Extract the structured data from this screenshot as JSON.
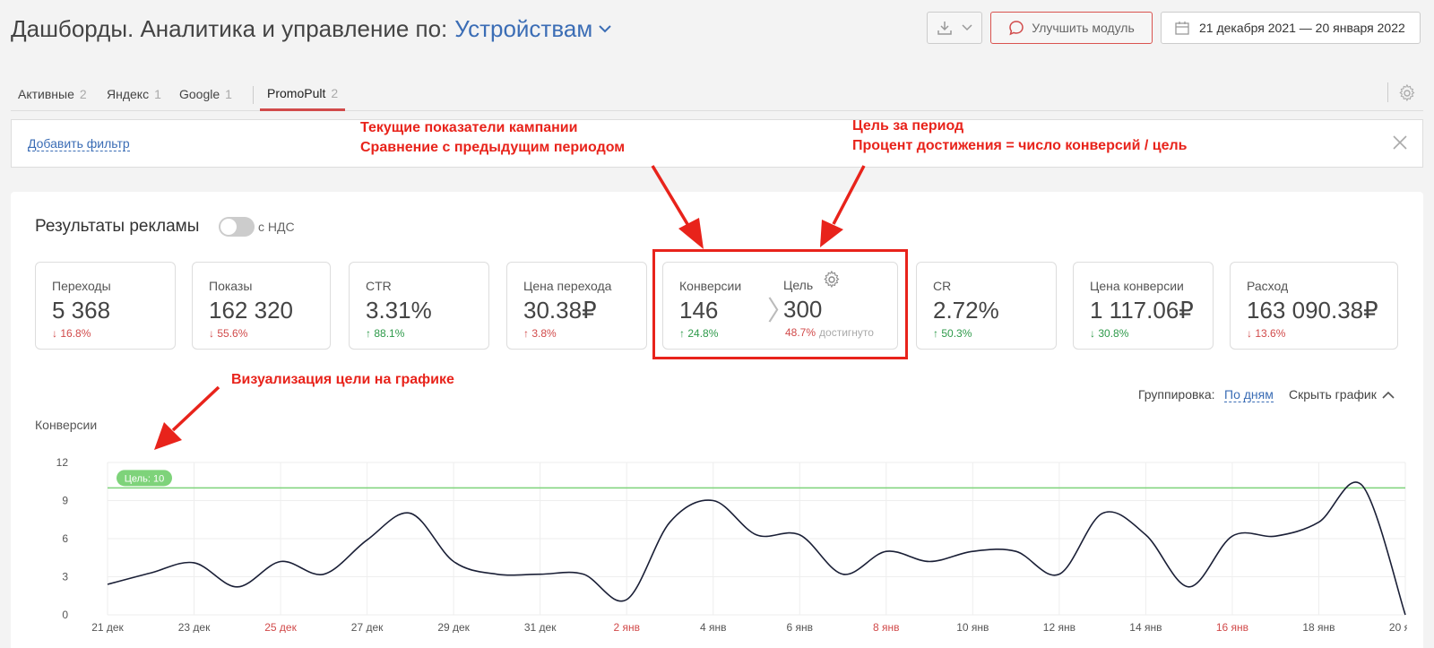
{
  "header": {
    "title": "Дашборды. Аналитика и управление по:",
    "dimension": "Устройствам",
    "improve_label": "Улучшить модуль",
    "date_range": "21 декабря 2021 — 20 января 2022"
  },
  "tabs": [
    {
      "label": "Активные",
      "count": "2"
    },
    {
      "label": "Яндекс",
      "count": "1"
    },
    {
      "label": "Google",
      "count": "1"
    },
    {
      "label": "PromoPult",
      "count": "2"
    }
  ],
  "filter": {
    "add_label": "Добавить фильтр"
  },
  "results": {
    "title": "Результаты рекламы",
    "vat_label": "с НДС",
    "vat_on": false
  },
  "metrics": [
    {
      "label": "Переходы",
      "value": "5 368",
      "delta": "16.8%",
      "direction": "down"
    },
    {
      "label": "Показы",
      "value": "162 320",
      "delta": "55.6%",
      "direction": "down"
    },
    {
      "label": "CTR",
      "value": "3.31%",
      "delta": "88.1%",
      "direction": "up"
    },
    {
      "label": "Цена перехода",
      "value": "30.38₽",
      "delta": "3.8%",
      "direction": "down"
    },
    {
      "label": "Конверсии",
      "value": "146",
      "delta": "24.8%",
      "direction": "up"
    },
    {
      "label": "CR",
      "value": "2.72%",
      "delta": "50.3%",
      "direction": "up"
    },
    {
      "label": "Цена конверсии",
      "value": "1 117.06₽",
      "delta": "30.8%",
      "direction": "up"
    },
    {
      "label": "Расход",
      "value": "163 090.38₽",
      "delta": "13.6%",
      "direction": "down"
    }
  ],
  "goal": {
    "label": "Цель",
    "value": "300",
    "percent": "48.7%",
    "percent_label": "достигнуто"
  },
  "chart_controls": {
    "grouping_label": "Группировка:",
    "grouping_value": "По дням",
    "hide_label": "Скрыть график"
  },
  "chart_data": {
    "type": "line",
    "title": "Конверсии",
    "x": [
      "21 дек",
      "22 дек",
      "23 дек",
      "24 дек",
      "25 дек",
      "26 дек",
      "27 дек",
      "28 дек",
      "29 дек",
      "30 дек",
      "31 дек",
      "1 янв",
      "2 янв",
      "3 янв",
      "4 янв",
      "5 янв",
      "6 янв",
      "7 янв",
      "8 янв",
      "9 янв",
      "10 янв",
      "11 янв",
      "12 янв",
      "13 янв",
      "14 янв",
      "15 янв",
      "16 янв",
      "17 янв",
      "18 янв",
      "19 янв",
      "20 янв"
    ],
    "series": [
      {
        "values": [
          2.4,
          3.3,
          4.1,
          2.2,
          4.2,
          3.2,
          5.9,
          8.0,
          4.2,
          3.2,
          3.2,
          3.2,
          1.2,
          7.3,
          9.0,
          6.3,
          6.3,
          3.2,
          5.0,
          4.2,
          5.0,
          5.0,
          3.2,
          8.0,
          6.3,
          2.2,
          6.2,
          6.2,
          7.3,
          10.2,
          0.0
        ]
      }
    ],
    "xticks": [
      "21 дек",
      "23 дек",
      "25 дек",
      "27 дек",
      "29 дек",
      "31 дек",
      "2 янв",
      "4 янв",
      "6 янв",
      "8 янв",
      "10 янв",
      "12 янв",
      "14 янв",
      "16 янв",
      "18 янв",
      "20 янв"
    ],
    "weekend_ticks": [
      "25 дек",
      "2 янв",
      "8 янв",
      "16 янв"
    ],
    "yticks": [
      "0",
      "3",
      "6",
      "9",
      "12"
    ],
    "ylim": [
      0,
      12
    ],
    "goal_line": 10,
    "goal_label": "Цель: 10",
    "colors": {
      "line": "#1a1f36",
      "goal": "#7ed37a",
      "weekend": "#d14a4a",
      "grid": "#eeeeee"
    }
  },
  "annotations": {
    "current_1": "Текущие показатели кампании",
    "current_2": "Сравнение с предыдущим периодом",
    "goal_1": "Цель за период",
    "goal_2": "Процент достижения = число конверсий / цель",
    "chart_goal": "Визуализация цели на графике"
  }
}
